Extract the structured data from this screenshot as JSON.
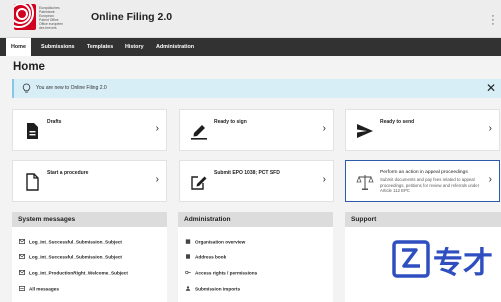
{
  "header": {
    "logo_text": "Europäisches\nPatentamt\nEuropean\nPatent Office\nOffice européen\ndes brevets",
    "app_title": "Online Filing 2.0",
    "menu_icon": "kebab-menu-icon"
  },
  "nav": {
    "items": [
      {
        "label": "Home",
        "active": true
      },
      {
        "label": "Submissions"
      },
      {
        "label": "Templates"
      },
      {
        "label": "History"
      },
      {
        "label": "Administration"
      }
    ]
  },
  "page_title": "Home",
  "banner": {
    "icon": "lightbulb-icon",
    "text": "You are new to Online Filing 2.0",
    "close_icon": "close-icon"
  },
  "cards": [
    {
      "label": "Drafts",
      "icon": "document-icon"
    },
    {
      "label": "Ready to sign",
      "icon": "pen-sign-icon"
    },
    {
      "label": "Ready to send",
      "icon": "send-icon"
    },
    {
      "label": "Start a procedure",
      "icon": "new-document-icon"
    },
    {
      "label": "Submit EPO 1038; PCT SFD",
      "icon": "edit-document-icon"
    },
    {
      "label": "Perform an action in appeal proceedings",
      "description": "Submit documents and pay fees related to appeal proceedings, petitions for review and referrals under Article 112 EPC",
      "icon": "scales-icon"
    }
  ],
  "panels": {
    "system_messages": {
      "title": "System messages",
      "items": [
        "Log_Int_Successful_Submission_Subject",
        "Log_Int_Successful_Submission_Subject",
        "Log_Int_ProductionRight_Welcome_Subject",
        "All messages"
      ]
    },
    "administration": {
      "title": "Administration",
      "items": [
        "Organisation overview",
        "Address book",
        "Access rights / permissions",
        "Submission imports"
      ]
    },
    "support": {
      "title": "Support"
    }
  },
  "watermark": {
    "text": "专才"
  },
  "colors": {
    "nav_bg": "#323232",
    "banner_bg": "#d7eef7",
    "accent_blue": "#2e5aac",
    "logo_red": "#d1001f"
  }
}
